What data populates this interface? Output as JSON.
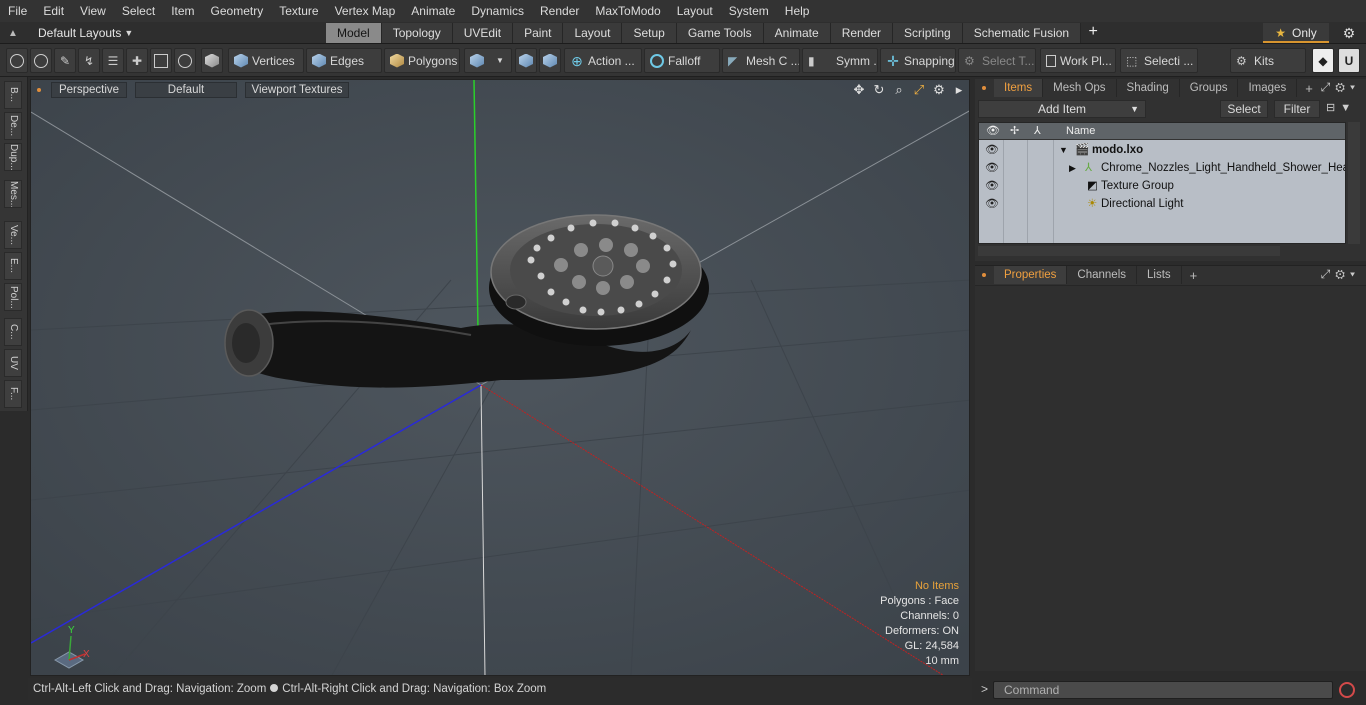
{
  "menu": [
    "File",
    "Edit",
    "View",
    "Select",
    "Item",
    "Geometry",
    "Texture",
    "Vertex Map",
    "Animate",
    "Dynamics",
    "Render",
    "MaxToModo",
    "Layout",
    "System",
    "Help"
  ],
  "layout_selector": "Default Layouts",
  "layout_tabs": [
    "Model",
    "Topology",
    "UVEdit",
    "Paint",
    "Layout",
    "Setup",
    "Game Tools",
    "Animate",
    "Render",
    "Scripting",
    "Schematic Fusion"
  ],
  "active_layout_tab": "Model",
  "only_label": "Only",
  "toolbar": {
    "vertices": "Vertices",
    "edges": "Edges",
    "polygons": "Polygons",
    "action": "Action ...",
    "falloff": "Falloff",
    "mesh": "Mesh C ...",
    "symmetry": "Symm ...",
    "snapping": "Snapping",
    "select_t": "Select T...",
    "work_plane": "Work Pl...",
    "selection": "Selecti ...",
    "kits": "Kits"
  },
  "left_tabs": [
    "B...",
    "De...",
    "Dup...",
    "Mes...",
    "Ve...",
    "E...",
    "Pol...",
    "C...",
    "UV",
    "F..."
  ],
  "viewport": {
    "view_mode": "Perspective",
    "shading": "Default",
    "textures": "Viewport Textures",
    "axis_y": "Y",
    "axis_x": "X",
    "info": {
      "selection": "No Items",
      "polygons": "Polygons : Face",
      "channels": "Channels: 0",
      "deformers": "Deformers: ON",
      "gl": "GL: 24,584",
      "scale": "10 mm"
    }
  },
  "status": {
    "left": "Ctrl-Alt-Left Click and Drag: Navigation: Zoom",
    "right": "Ctrl-Alt-Right Click and Drag: Navigation: Box Zoom"
  },
  "items_panel": {
    "tabs": [
      "Items",
      "Mesh Ops",
      "Shading",
      "Groups",
      "Images"
    ],
    "active_tab": "Items",
    "add_item": "Add Item",
    "select": "Select",
    "filter": "Filter",
    "column_name": "Name",
    "rows": [
      {
        "label": "modo.lxo",
        "bold": true
      },
      {
        "label": "Chrome_Nozzles_Light_Handheld_Shower_Head",
        "bold": false
      },
      {
        "label": "Texture Group",
        "bold": false
      },
      {
        "label": "Directional Light",
        "bold": false
      }
    ]
  },
  "properties_panel": {
    "tabs": [
      "Properties",
      "Channels",
      "Lists"
    ],
    "active_tab": "Properties"
  },
  "command": {
    "placeholder": "Command"
  }
}
